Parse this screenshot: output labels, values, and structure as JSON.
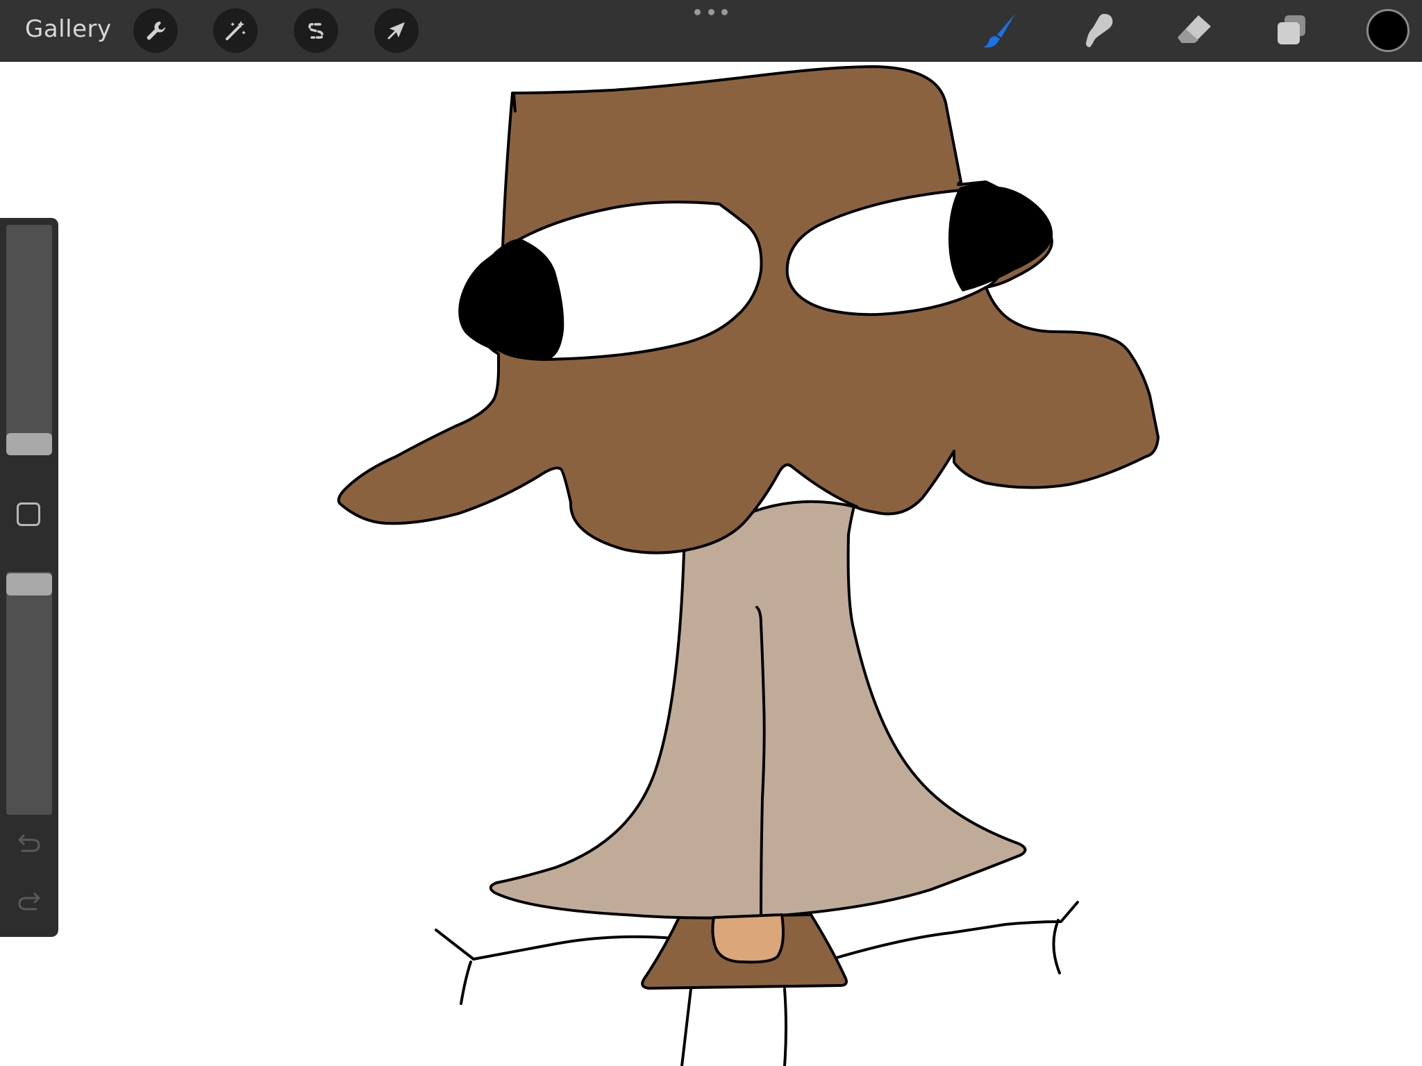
{
  "topbar": {
    "gallery_label": "Gallery",
    "actions_icon": "wrench-icon",
    "adjustments_icon": "magic-wand-icon",
    "selection_icon": "selection-s-icon",
    "transform_icon": "arrow-cursor-icon",
    "more_icon": "more-dots-icon",
    "brush_icon": "brush-icon",
    "smudge_icon": "smudge-finger-icon",
    "eraser_icon": "eraser-icon",
    "layers_icon": "layers-icon",
    "current_color": "#000000",
    "active_tool_color": "#1a73e8"
  },
  "sidebar": {
    "brush_size_level": 0.04,
    "opacity_level": 1.0,
    "undo_icon": "undo-icon",
    "redo_icon": "redo-icon"
  },
  "colors": {
    "cap_brown": "#8b6240",
    "stem_tan": "#c0ab99",
    "nose_peach": "#dba67a",
    "outline": "#000000",
    "eye_white": "#ffffff"
  }
}
